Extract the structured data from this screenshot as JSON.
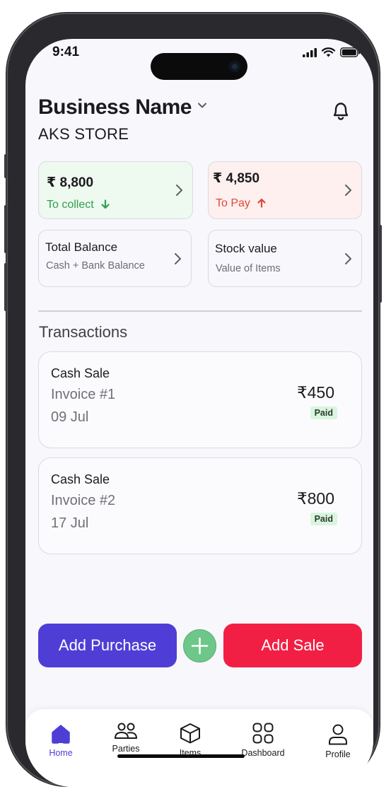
{
  "status": {
    "time": "9:41"
  },
  "header": {
    "business_name": "Business Name",
    "store_name": "AKS STORE"
  },
  "summary": {
    "collect": {
      "amount": "₹ 8,800",
      "label": "To collect"
    },
    "pay": {
      "amount": "₹ 4,850",
      "label": "To Pay"
    },
    "balance": {
      "title": "Total Balance",
      "subtitle": "Cash + Bank Balance"
    },
    "stock": {
      "title": "Stock value",
      "subtitle": "Value of Items"
    }
  },
  "transactions": {
    "title": "Transactions",
    "items": [
      {
        "type": "Cash Sale",
        "invoice": "Invoice #1",
        "date": "09 Jul",
        "amount": "₹450",
        "status": "Paid"
      },
      {
        "type": "Cash Sale",
        "invoice": "Invoice #2",
        "date": "17 Jul",
        "amount": "₹800",
        "status": "Paid"
      }
    ]
  },
  "actions": {
    "purchase_label": "Add Purchase",
    "sale_label": "Add Sale"
  },
  "nav": {
    "items": [
      {
        "label": "Home",
        "icon": "home-icon"
      },
      {
        "label": "Parties",
        "icon": "users-icon"
      },
      {
        "label": "Items",
        "icon": "box-icon"
      },
      {
        "label": "Dashboard",
        "icon": "grid-icon"
      },
      {
        "label": "Profile",
        "icon": "user-icon"
      }
    ]
  },
  "colors": {
    "accent": "#4f3ed6",
    "sale": "#f21f45",
    "add": "#6dc788",
    "collect_green": "#2f9e4f",
    "pay_red": "#e0473a"
  }
}
